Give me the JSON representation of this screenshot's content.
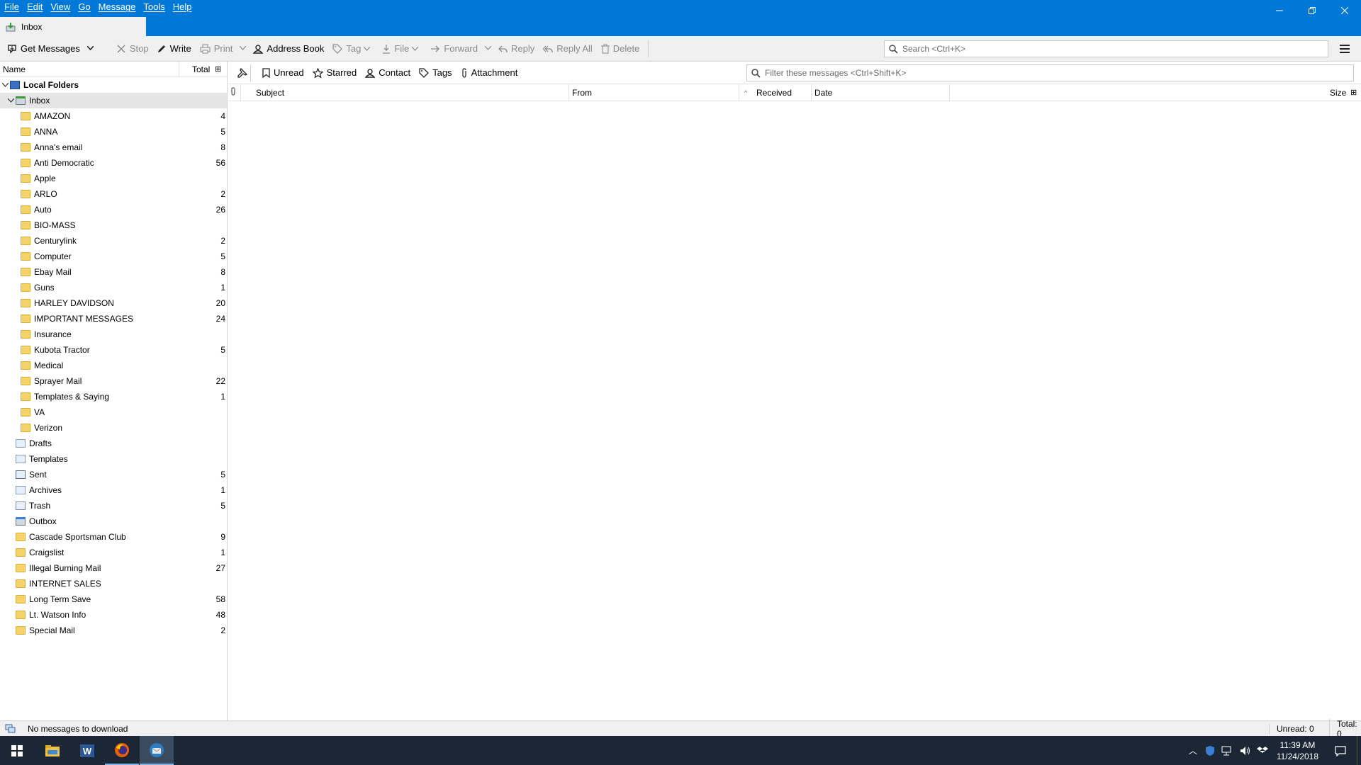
{
  "menu": [
    "File",
    "Edit",
    "View",
    "Go",
    "Message",
    "Tools",
    "Help"
  ],
  "tab": {
    "label": "Inbox"
  },
  "toolbar": {
    "get_messages": "Get Messages",
    "stop": "Stop",
    "write": "Write",
    "print": "Print",
    "address_book": "Address Book",
    "tag": "Tag",
    "file": "File",
    "forward": "Forward",
    "reply": "Reply",
    "reply_all": "Reply All",
    "delete": "Delete"
  },
  "search": {
    "placeholder": "Search <Ctrl+K>"
  },
  "folder_header": {
    "name": "Name",
    "total": "Total"
  },
  "folders": [
    {
      "label": "Local Folders",
      "count": "",
      "icon": "computer",
      "level": 0,
      "twisty": "v",
      "bold": true
    },
    {
      "label": "Inbox",
      "count": "",
      "icon": "inbox",
      "level": 1,
      "twisty": "v",
      "selected": true
    },
    {
      "label": "AMAZON",
      "count": "4",
      "icon": "folder",
      "level": 2
    },
    {
      "label": "ANNA",
      "count": "5",
      "icon": "folder",
      "level": 2
    },
    {
      "label": "Anna's email",
      "count": "8",
      "icon": "folder",
      "level": 2
    },
    {
      "label": "Anti Democratic",
      "count": "56",
      "icon": "folder",
      "level": 2
    },
    {
      "label": "Apple",
      "count": "",
      "icon": "folder",
      "level": 2
    },
    {
      "label": "ARLO",
      "count": "2",
      "icon": "folder",
      "level": 2
    },
    {
      "label": "Auto",
      "count": "26",
      "icon": "folder",
      "level": 2
    },
    {
      "label": "BIO-MASS",
      "count": "",
      "icon": "folder",
      "level": 2
    },
    {
      "label": "Centurylink",
      "count": "2",
      "icon": "folder",
      "level": 2
    },
    {
      "label": "Computer",
      "count": "5",
      "icon": "folder",
      "level": 2
    },
    {
      "label": "Ebay Mail",
      "count": "8",
      "icon": "folder",
      "level": 2
    },
    {
      "label": "Guns",
      "count": "1",
      "icon": "folder",
      "level": 2
    },
    {
      "label": "HARLEY DAVIDSON",
      "count": "20",
      "icon": "folder",
      "level": 2
    },
    {
      "label": "IMPORTANT MESSAGES",
      "count": "24",
      "icon": "folder",
      "level": 2
    },
    {
      "label": "Insurance",
      "count": "",
      "icon": "folder",
      "level": 2
    },
    {
      "label": "Kubota Tractor",
      "count": "5",
      "icon": "folder",
      "level": 2
    },
    {
      "label": "Medical",
      "count": "",
      "icon": "folder",
      "level": 2
    },
    {
      "label": "Sprayer Mail",
      "count": "22",
      "icon": "folder",
      "level": 2
    },
    {
      "label": "Templates & Saying",
      "count": "1",
      "icon": "folder",
      "level": 2
    },
    {
      "label": "VA",
      "count": "",
      "icon": "folder",
      "level": 2
    },
    {
      "label": "Verizon",
      "count": "",
      "icon": "folder",
      "level": 2
    },
    {
      "label": "Drafts",
      "count": "",
      "icon": "drafts",
      "level": 1
    },
    {
      "label": "Templates",
      "count": "",
      "icon": "templates",
      "level": 1
    },
    {
      "label": "Sent",
      "count": "5",
      "icon": "sent",
      "level": 1
    },
    {
      "label": "Archives",
      "count": "1",
      "icon": "archives",
      "level": 1
    },
    {
      "label": "Trash",
      "count": "5",
      "icon": "trash",
      "level": 1
    },
    {
      "label": "Outbox",
      "count": "",
      "icon": "outbox",
      "level": 1
    },
    {
      "label": "Cascade Sportsman Club",
      "count": "9",
      "icon": "folder",
      "level": 1
    },
    {
      "label": "Craigslist",
      "count": "1",
      "icon": "folder",
      "level": 1
    },
    {
      "label": "Illegal Burning Mail",
      "count": "27",
      "icon": "folder",
      "level": 1
    },
    {
      "label": "INTERNET SALES",
      "count": "",
      "icon": "folder",
      "level": 1
    },
    {
      "label": "Long Term Save",
      "count": "58",
      "icon": "folder",
      "level": 1
    },
    {
      "label": "Lt. Watson Info",
      "count": "48",
      "icon": "folder",
      "level": 1
    },
    {
      "label": "Special Mail",
      "count": "2",
      "icon": "folder",
      "level": 1
    }
  ],
  "quickfilter": {
    "unread": "Unread",
    "starred": "Starred",
    "contact": "Contact",
    "tags": "Tags",
    "attachment": "Attachment",
    "placeholder": "Filter these messages <Ctrl+Shift+K>"
  },
  "columns": {
    "subject": "Subject",
    "from": "From",
    "received": "Received",
    "date": "Date",
    "size": "Size"
  },
  "status": {
    "text": "No messages to download",
    "unread": "Unread: 0",
    "total": "Total: 0"
  },
  "clock": {
    "time": "11:39 AM",
    "date": "11/24/2018"
  },
  "colors": {
    "titlebar": "#0078d7",
    "taskbar": "#1b2735"
  }
}
